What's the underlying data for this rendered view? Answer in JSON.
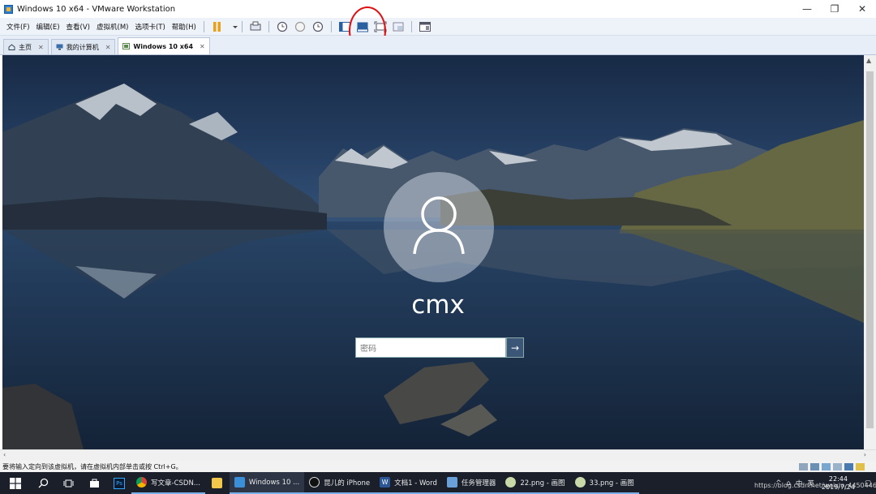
{
  "window": {
    "title": "Windows 10 x64 - VMware Workstation"
  },
  "menu": [
    "文件(F)",
    "编辑(E)",
    "查看(V)",
    "虚拟机(M)",
    "选项卡(T)",
    "帮助(H)"
  ],
  "tabs": [
    {
      "label": "主页",
      "icon": "home-icon"
    },
    {
      "label": "我的计算机",
      "icon": "computer-icon"
    },
    {
      "label": "Windows 10 x64",
      "icon": "vm-icon",
      "active": true
    }
  ],
  "login": {
    "username": "cmx",
    "password_placeholder": "密码",
    "submit": "→"
  },
  "status": {
    "text": "要将输入定向到该虚拟机，请在虚拟机内部单击或按 Ctrl+G。"
  },
  "taskbar": {
    "apps": [
      {
        "label": "写文章-CSDN...",
        "icon": "chrome-icon",
        "color": "#e9a92f"
      },
      {
        "label": "",
        "icon": "folder-icon",
        "color": "#f2c84b"
      },
      {
        "label": "Windows 10 ...",
        "icon": "vmware-icon",
        "color": "#3b8ed8"
      },
      {
        "label": "昆儿的 iPhone",
        "icon": "qq-icon",
        "color": "#222"
      },
      {
        "label": "文档1 - Word",
        "icon": "word-icon",
        "color": "#2b5797"
      },
      {
        "label": "任务管理器",
        "icon": "task-manager-icon",
        "color": "#6aa0d8"
      },
      {
        "label": "22.png - 画图",
        "icon": "paint-icon",
        "color": "#c9d9a8"
      },
      {
        "label": "33.png - 画图",
        "icon": "paint-icon",
        "color": "#c9d9a8"
      }
    ],
    "tray_lang": "中",
    "tray_ime": "英",
    "clock_time": "22:44",
    "clock_date": "2019/7/24"
  },
  "watermark": "https://blog.csdn.net/weixin_44504462",
  "colors": {
    "highlight_circle": "#e01010",
    "taskbar": "#1a1f2a",
    "menubar": "#eef3fa"
  }
}
